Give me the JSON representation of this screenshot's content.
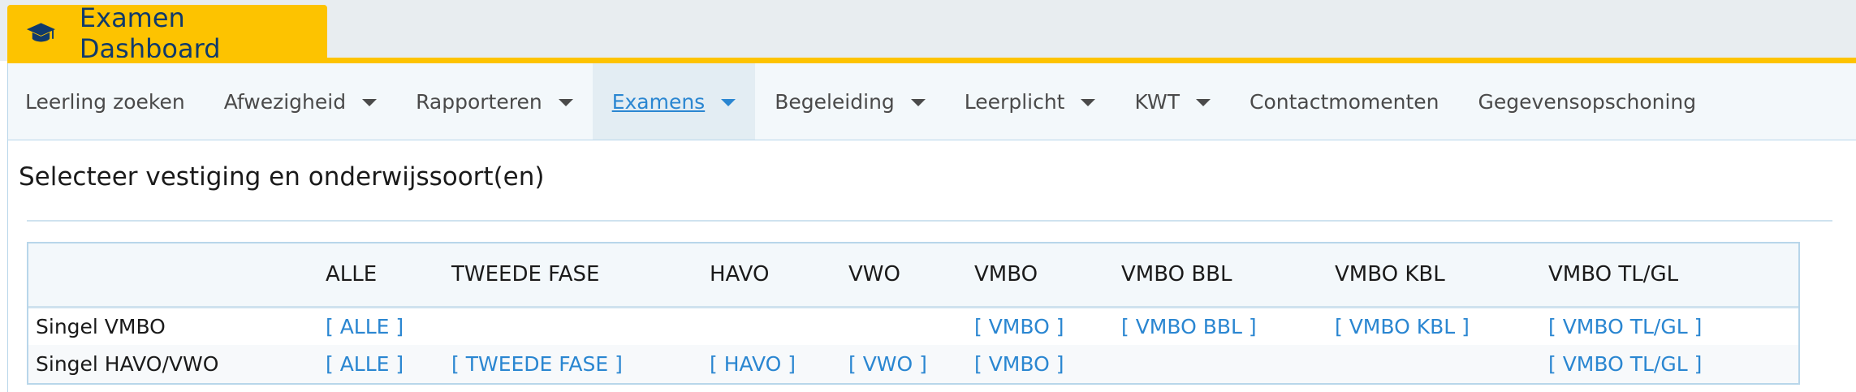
{
  "app": {
    "title": "Examen Dashboard",
    "icon": "graduation-cap-icon",
    "accent_color": "#fdc300",
    "title_color": "#103a6b"
  },
  "nav": {
    "link_color": "#2a86d1",
    "items": [
      {
        "label": "Leerling zoeken",
        "dropdown": false,
        "active": false
      },
      {
        "label": "Afwezigheid",
        "dropdown": true,
        "active": false
      },
      {
        "label": "Rapporteren",
        "dropdown": true,
        "active": false
      },
      {
        "label": "Examens",
        "dropdown": true,
        "active": true
      },
      {
        "label": "Begeleiding",
        "dropdown": true,
        "active": false
      },
      {
        "label": "Leerplicht",
        "dropdown": true,
        "active": false
      },
      {
        "label": "KWT",
        "dropdown": true,
        "active": false
      },
      {
        "label": "Contactmomenten",
        "dropdown": false,
        "active": false
      },
      {
        "label": "Gegevensopschoning",
        "dropdown": false,
        "active": false
      }
    ]
  },
  "section": {
    "title": "Selecteer vestiging en onderwijssoort(en)"
  },
  "table": {
    "headers": [
      "",
      "ALLE",
      "TWEEDE FASE",
      "HAVO",
      "VWO",
      "VMBO",
      "VMBO BBL",
      "VMBO KBL",
      "VMBO TL/GL"
    ],
    "rows": [
      {
        "label": "Singel VMBO",
        "cells": [
          "[ ALLE ]",
          "",
          "",
          "",
          "[ VMBO ]",
          "[ VMBO BBL ]",
          "[ VMBO KBL ]",
          "[ VMBO TL/GL ]"
        ]
      },
      {
        "label": "Singel HAVO/VWO",
        "cells": [
          "[ ALLE ]",
          "[ TWEEDE FASE ]",
          "[ HAVO ]",
          "[ VWO ]",
          "[ VMBO ]",
          "",
          "",
          "[ VMBO TL/GL ]"
        ]
      }
    ]
  }
}
